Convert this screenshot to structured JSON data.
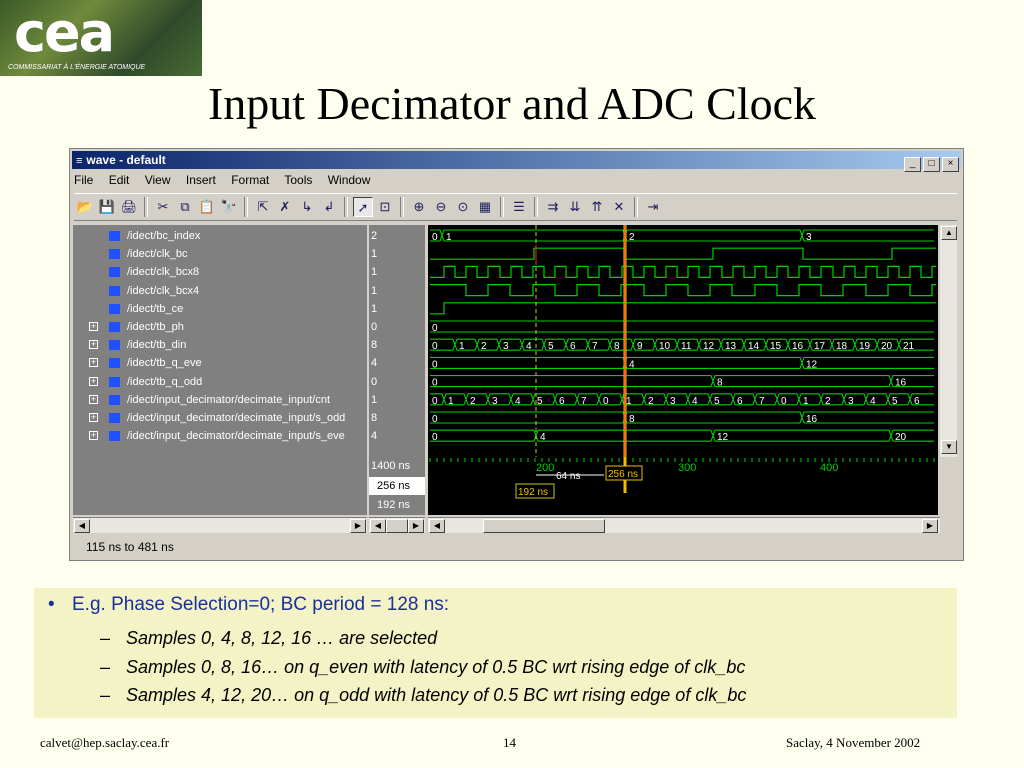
{
  "logo": {
    "letters": "cea",
    "subtitle": "COMMISSARIAT À L'ÉNERGIE ATOMIQUE"
  },
  "slide_title": "Input Decimator and ADC Clock",
  "window": {
    "title": "wave - default",
    "title_icon": "wave-icon",
    "buttons": [
      "_",
      "□",
      "×"
    ],
    "menu": [
      "File",
      "Edit",
      "View",
      "Insert",
      "Format",
      "Tools",
      "Window"
    ],
    "toolbar_icons": [
      "open-icon",
      "save-icon",
      "print-icon",
      "|",
      "cut-icon",
      "copy-icon",
      "paste-icon",
      "find-icon",
      "|",
      "select-icon",
      "delete-icon",
      "insert-icon",
      "expand-icon",
      "|",
      "pointer-icon",
      "zoom-mode-icon",
      "|",
      "zoom-in-icon",
      "zoom-out-icon",
      "zoom-full-icon",
      "zoom-area-icon",
      "|",
      "edit-icon",
      "|",
      "find-edge-icon",
      "next-edge-icon",
      "prev-edge-icon",
      "remove-cursor-icon",
      "|",
      "add-cursor-icon"
    ],
    "toolbar_glyphs": [
      "📂",
      "💾",
      "🖨",
      "|",
      "✂",
      "⧉",
      "📋",
      "🔭",
      "|",
      "⇱",
      "✗",
      "↳",
      "↲",
      "|",
      "➚",
      "⊡",
      "|",
      "⊕",
      "⊖",
      "⊙",
      "▦",
      "|",
      "☰",
      "|",
      "⇉",
      "⇊",
      "⇈",
      "✕",
      "|",
      "⇥"
    ],
    "signals": [
      {
        "name": "/idect/bc_index",
        "value": "2",
        "expandable": false
      },
      {
        "name": "/idect/clk_bc",
        "value": "1",
        "expandable": false
      },
      {
        "name": "/idect/clk_bcx8",
        "value": "1",
        "expandable": false
      },
      {
        "name": "/idect/clk_bcx4",
        "value": "1",
        "expandable": false
      },
      {
        "name": "/idect/tb_ce",
        "value": "1",
        "expandable": false
      },
      {
        "name": "/idect/tb_ph",
        "value": "0",
        "expandable": true
      },
      {
        "name": "/idect/tb_din",
        "value": "8",
        "expandable": true
      },
      {
        "name": "/idect/tb_q_eve",
        "value": "4",
        "expandable": true
      },
      {
        "name": "/idect/tb_q_odd",
        "value": "0",
        "expandable": true
      },
      {
        "name": "/idect/input_decimator/decimate_input/cnt",
        "value": "1",
        "expandable": true
      },
      {
        "name": "/idect/input_decimator/decimate_input/s_odd",
        "value": "8",
        "expandable": true
      },
      {
        "name": "/idect/input_decimator/decimate_input/s_eve",
        "value": "4",
        "expandable": true
      }
    ],
    "expand_glyph": "+",
    "cursors": {
      "now": "1400 ns",
      "c1": "256 ns",
      "c2": "192 ns"
    },
    "timeline": {
      "labels": [
        "200",
        "300",
        "400"
      ],
      "delta": "64 ns",
      "c1_tag": "256 ns",
      "c2_tag": "192 ns"
    },
    "status": "115 ns to 481 ns",
    "scroll_arrows": {
      "left": "◀",
      "right": "▶",
      "up": "▲",
      "down": "▼"
    }
  },
  "bus_labels": {
    "bc_index": [
      "0",
      "1",
      "2",
      "3"
    ],
    "tb_ph": [
      "0"
    ],
    "tb_din": [
      "0",
      "1",
      "2",
      "3",
      "4",
      "5",
      "6",
      "7",
      "8",
      "9",
      "10",
      "11",
      "12",
      "13",
      "14",
      "15",
      "16",
      "17",
      "18",
      "19",
      "20",
      "21"
    ],
    "tb_q_eve": [
      "0",
      "4",
      "12"
    ],
    "tb_q_odd": [
      "0",
      "8",
      "16"
    ],
    "cnt": [
      "0",
      "1",
      "2",
      "3",
      "4",
      "5",
      "6",
      "7",
      "0",
      "1",
      "2",
      "3",
      "4",
      "5",
      "6",
      "7",
      "0",
      "1",
      "2",
      "3",
      "4",
      "5",
      "6"
    ],
    "s_odd": [
      "0",
      "8",
      "16"
    ],
    "s_eve": [
      "0",
      "4",
      "12",
      "20"
    ]
  },
  "notes": {
    "bullet_glyph": "•",
    "dash_glyph": "–",
    "main": "E.g. Phase Selection=0; BC period = 128 ns:",
    "subs": [
      "Samples 0, 4, 8, 12, 16 … are selected",
      "Samples 0, 8, 16… on q_even with latency of 0.5 BC wrt rising edge of clk_bc",
      "Samples 4, 12, 20… on q_odd with latency of 0.5 BC wrt rising edge of clk_bc"
    ]
  },
  "footer": {
    "left": "calvet@hep.saclay.cea.fr",
    "center": "14",
    "right": "Saclay, 4 November 2002"
  },
  "colors": {
    "trace": "#00d000",
    "cursor1": "#f0c000",
    "cursor2": "#c8c820",
    "cursor_red": "#ff2020",
    "name_icon": "#2050ff",
    "bullet_text": "#1b2f9a"
  }
}
